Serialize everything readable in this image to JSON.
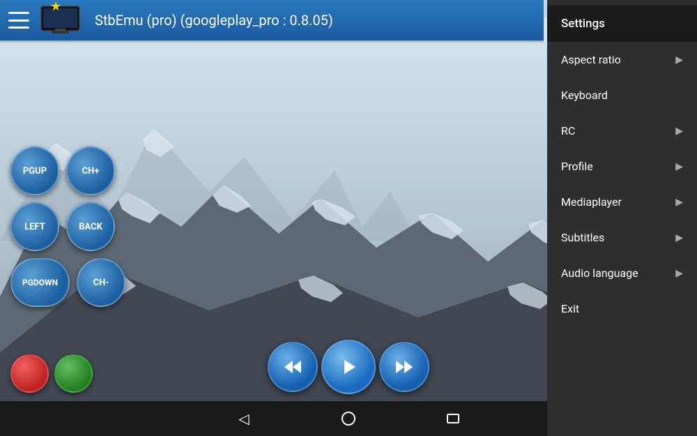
{
  "app": {
    "title": "StbEmu (pro) (googleplay_pro : 0.8.05)"
  },
  "menu": {
    "settings_label": "Settings",
    "items": [
      {
        "id": "settings",
        "label": "Settings",
        "has_arrow": false
      },
      {
        "id": "aspect-ratio",
        "label": "Aspect ratio",
        "has_arrow": true
      },
      {
        "id": "keyboard",
        "label": "Keyboard",
        "has_arrow": false
      },
      {
        "id": "rc",
        "label": "RC",
        "has_arrow": true
      },
      {
        "id": "profile",
        "label": "Profile",
        "has_arrow": true
      },
      {
        "id": "mediaplayer",
        "label": "Mediaplayer",
        "has_arrow": true
      },
      {
        "id": "subtitles",
        "label": "Subtitles",
        "has_arrow": true
      },
      {
        "id": "audio-language",
        "label": "Audio language",
        "has_arrow": true
      },
      {
        "id": "exit",
        "label": "Exit",
        "has_arrow": false
      }
    ]
  },
  "controls": {
    "pgup": "PGUP",
    "ch_plus": "CH+",
    "left": "LEFT",
    "back": "BACK",
    "pgdown": "PGDOWN",
    "ch_minus": "CH-"
  },
  "playback": {
    "rewind": "⏪",
    "play": "▶",
    "forward": "⏩"
  },
  "nav": {
    "back_icon": "◁",
    "home_icon": "○",
    "recents_icon": "▭"
  },
  "colors": {
    "header_blue": "#1a70b8",
    "menu_bg": "#2e2e2e",
    "menu_header_bg": "#1a1a1a",
    "btn_blue": "#1a60a8",
    "nav_bar": "#1a1a1a"
  }
}
